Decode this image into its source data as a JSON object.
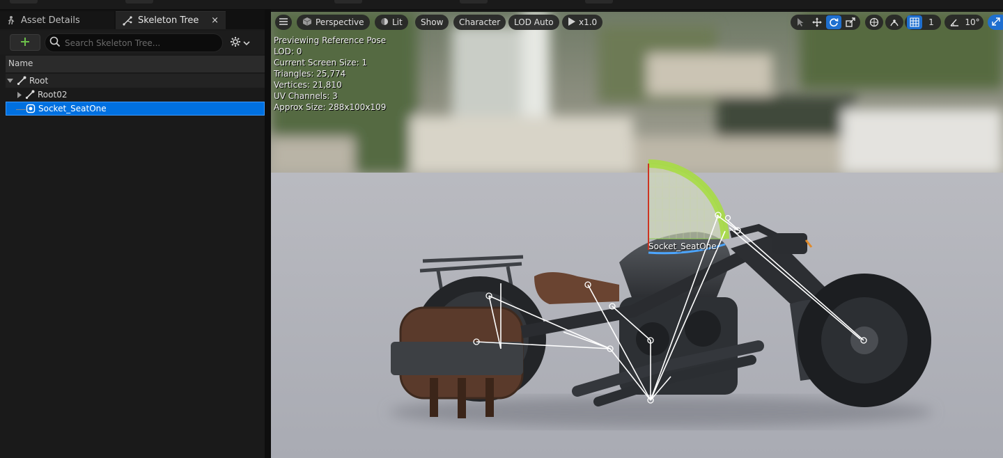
{
  "tabs": {
    "asset_details": "Asset Details",
    "skeleton_tree": "Skeleton Tree",
    "close_symbol": "×"
  },
  "search": {
    "placeholder": "Search Skeleton Tree..."
  },
  "tree": {
    "column_name": "Name",
    "items": [
      {
        "label": "Root",
        "depth": 0,
        "expanded": true,
        "type": "bone"
      },
      {
        "label": "Root02",
        "depth": 1,
        "expanded": false,
        "type": "bone"
      },
      {
        "label": "Socket_SeatOne",
        "depth": 1,
        "type": "socket",
        "selected": true
      }
    ]
  },
  "viewport": {
    "view_mode": "Perspective",
    "lighting": "Lit",
    "show": "Show",
    "character": "Character",
    "lod": "LOD Auto",
    "play_speed": "x1.0",
    "grid_size": "1",
    "rotation_snap": "10°",
    "socket_label": "Socket_SeatOne"
  },
  "stats": [
    "Previewing Reference Pose",
    "LOD: 0",
    "Current Screen Size: 1",
    "Triangles: 25,774",
    "Vertices: 21,810",
    "UV Channels: 3",
    "Approx Size: 288x100x109"
  ],
  "colors": {
    "selection": "#0070e0",
    "accent_green": "#8fd14f",
    "active_tool": "#1f6fcf"
  }
}
